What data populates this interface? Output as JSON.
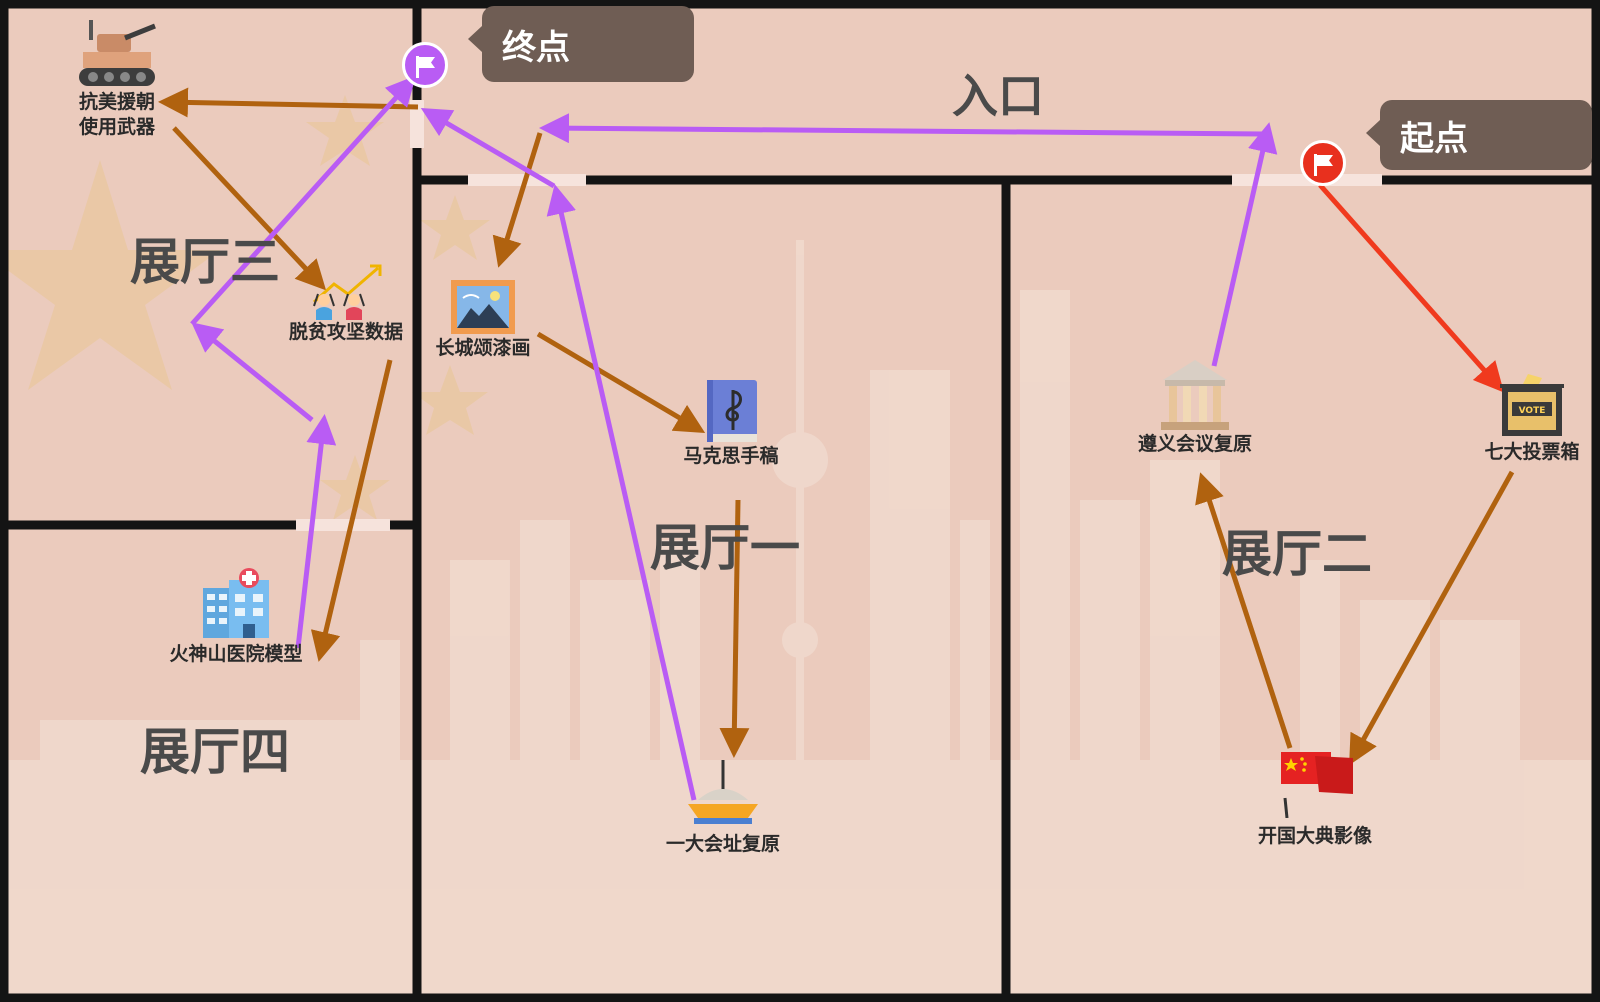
{
  "entrance": "入口",
  "markers": {
    "start": {
      "label": "起点",
      "color": "#e8301e"
    },
    "end": {
      "label": "终点",
      "color": "#b95cf4"
    }
  },
  "halls": [
    {
      "id": "hall-1",
      "name": "展厅一"
    },
    {
      "id": "hall-2",
      "name": "展厅二"
    },
    {
      "id": "hall-3",
      "name": "展厅三"
    },
    {
      "id": "hall-4",
      "name": "展厅四"
    }
  ],
  "exhibits": {
    "vote_box": {
      "label": "七大投票箱",
      "icon": "ballot-box-icon"
    },
    "founding": {
      "label": "开国大典影像",
      "icon": "red-flag-icon"
    },
    "zunyi": {
      "label": "遵义会议复原",
      "icon": "classical-building-icon"
    },
    "great_wall": {
      "label": "长城颂漆画",
      "icon": "painting-icon"
    },
    "marx": {
      "label": "马克思手稿",
      "icon": "music-book-icon"
    },
    "first_congress": {
      "label": "一大会址复原",
      "icon": "boat-icon"
    },
    "weapons": {
      "label_line1": "抗美援朝",
      "label_line2": "使用武器",
      "icon": "tank-icon"
    },
    "poverty": {
      "label": "脱贫攻坚数据",
      "icon": "growth-chart-icon"
    },
    "hospital": {
      "label": "火神山医院模型",
      "icon": "hospital-icon"
    }
  },
  "route_colors": {
    "primary": "#b0620f",
    "alternate": "#b95cf4",
    "start_leg": "#f03a1e"
  }
}
